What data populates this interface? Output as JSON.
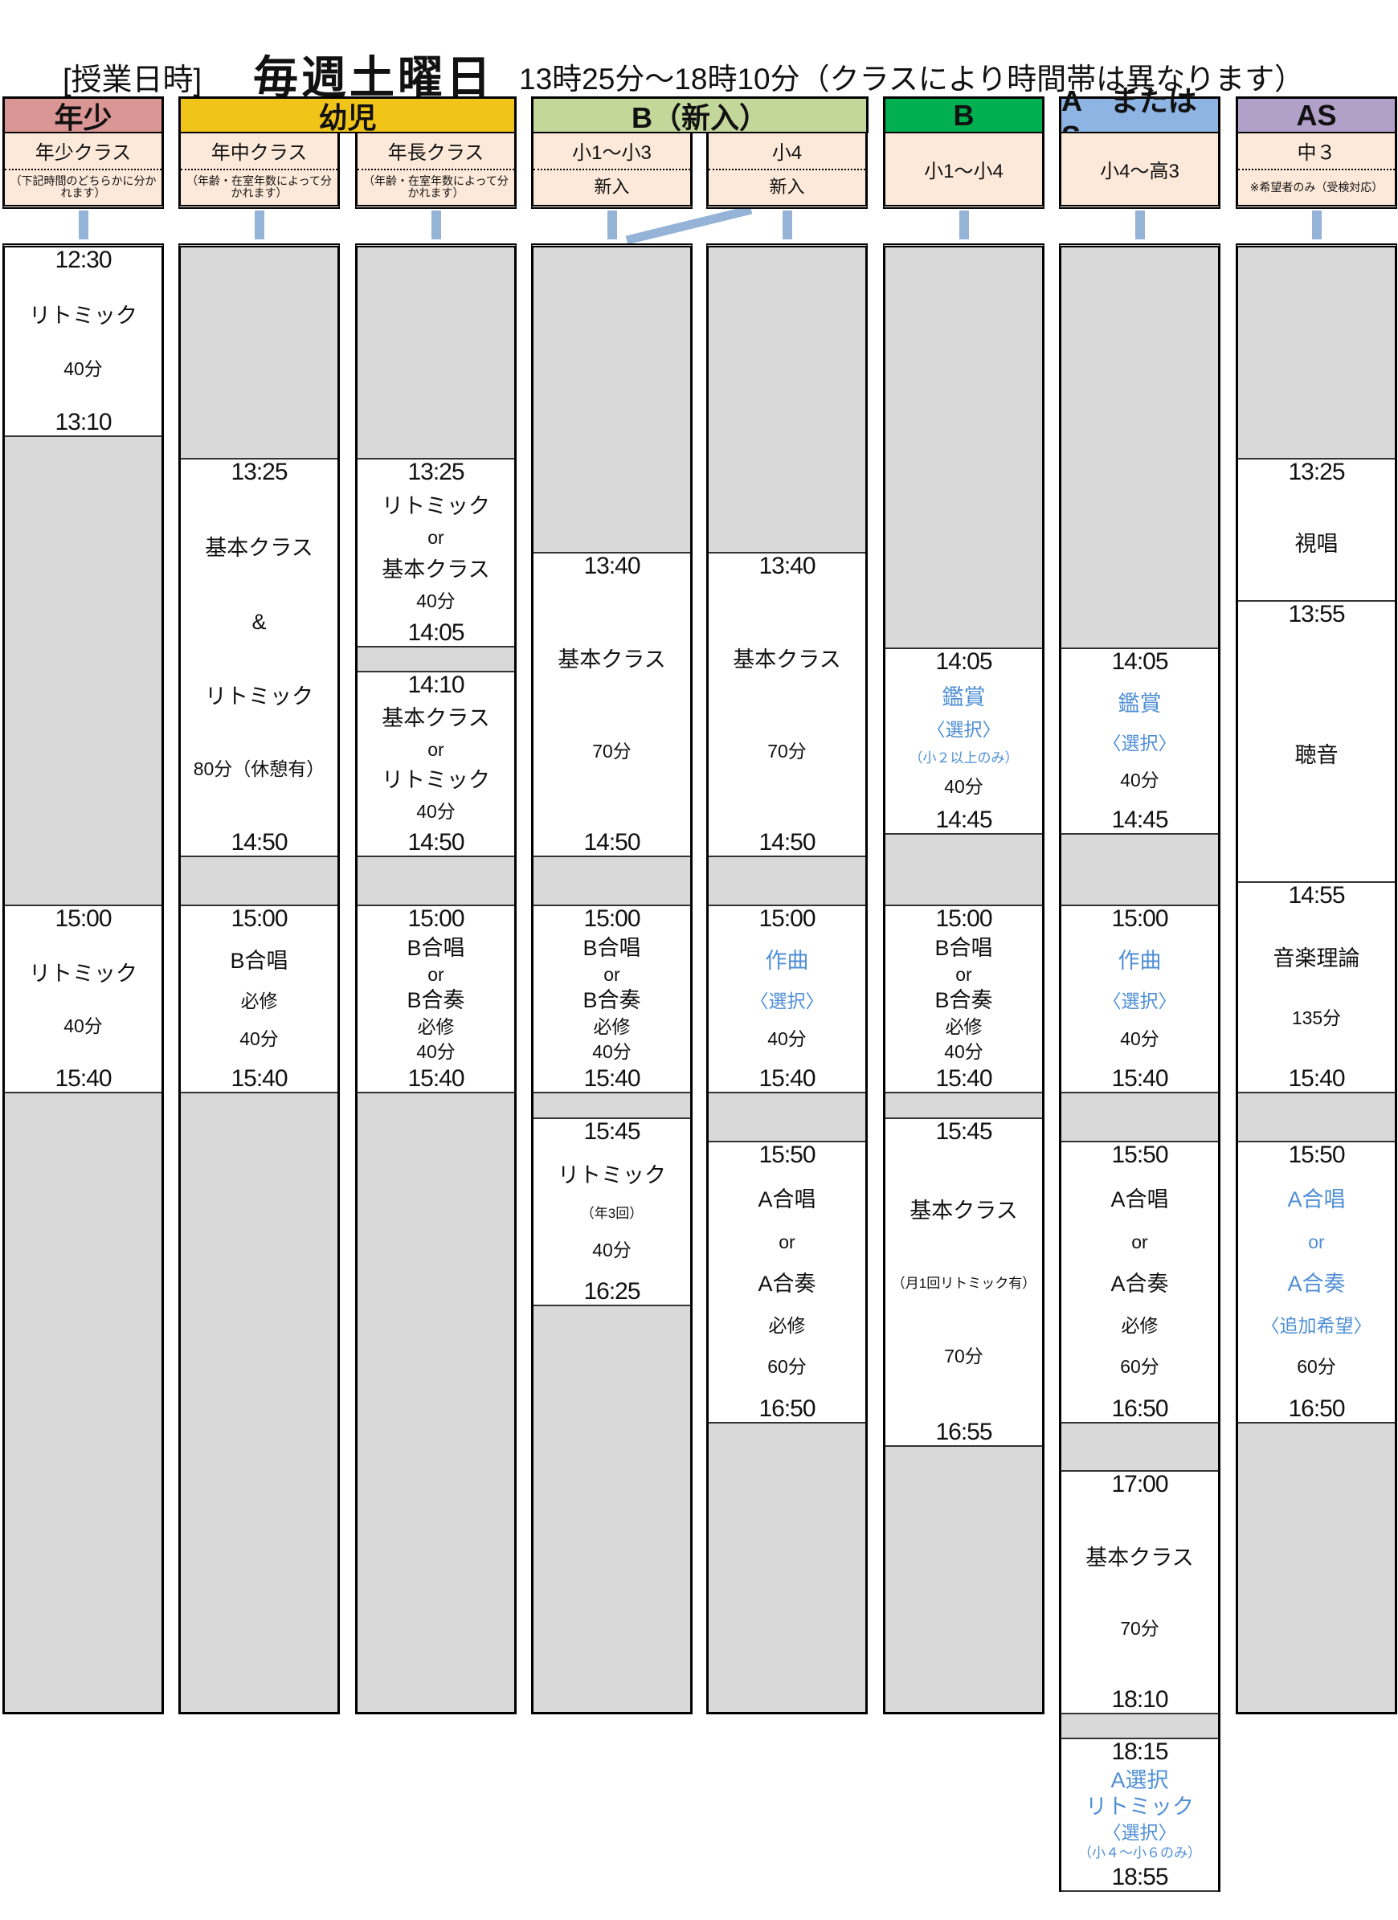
{
  "header": {
    "label": "[授業日時]",
    "day": "毎週土曜日",
    "hours": "13時25分～18時10分（クラスにより時間帯は異なります）"
  },
  "colors": {
    "nensho": "#DA9694",
    "yoji": "#F0C419",
    "b_shinnyu": "#C4D79B",
    "b": "#00B050",
    "a_or_s": "#8DB4E2",
    "as": "#B1A0C7",
    "subheader": "#FDE9D9",
    "empty_slot": "#D9D9D9",
    "connector": "#95B3D7",
    "optional_text": "#4F8FD6"
  },
  "groups": [
    {
      "label": "年少",
      "color": "#DA9694"
    },
    {
      "label": "幼児",
      "color": "#F0C419"
    },
    {
      "label": "B（新入）",
      "color": "#C4D79B"
    },
    {
      "label": "B",
      "color": "#00B050"
    },
    {
      "label": "A　または　S",
      "color": "#8DB4E2"
    },
    {
      "label": "AS",
      "color": "#B1A0C7"
    }
  ],
  "columns": [
    {
      "name": "年少クラス",
      "note": "（下記時間のどちらかに分かれます）",
      "blocks": [
        {
          "start": "12:30",
          "end": "13:10",
          "lines": [
            {
              "t": "リトミック",
              "k": "main"
            },
            {
              "t": "40分",
              "k": "dur"
            }
          ]
        },
        {
          "start": "15:00",
          "end": "15:40",
          "lines": [
            {
              "t": "リトミック",
              "k": "main"
            },
            {
              "t": "40分",
              "k": "dur"
            }
          ]
        }
      ]
    },
    {
      "name": "年中クラス",
      "note": "（年齢・在室年数によって分かれます）",
      "blocks": [
        {
          "start": "13:25",
          "end": "14:50",
          "lines": [
            {
              "t": "基本クラス",
              "k": "main"
            },
            {
              "t": "&",
              "k": "main"
            },
            {
              "t": "リトミック",
              "k": "main"
            },
            {
              "t": "80分（休憩有）",
              "k": "dur"
            }
          ]
        },
        {
          "start": "15:00",
          "end": "15:40",
          "lines": [
            {
              "t": "B合唱",
              "k": "main"
            },
            {
              "t": "必修",
              "k": "dur"
            },
            {
              "t": "40分",
              "k": "dur"
            }
          ]
        }
      ]
    },
    {
      "name": "年長クラス",
      "note": "（年齢・在室年数によって分かれます）",
      "blocks": [
        {
          "start": "13:25",
          "end": "14:05",
          "lines": [
            {
              "t": "リトミック",
              "k": "main"
            },
            {
              "t": "or",
              "k": "dur"
            },
            {
              "t": "基本クラス",
              "k": "main"
            },
            {
              "t": "40分",
              "k": "dur"
            }
          ]
        },
        {
          "start": "14:10",
          "end": "14:50",
          "lines": [
            {
              "t": "基本クラス",
              "k": "main"
            },
            {
              "t": "or",
              "k": "dur"
            },
            {
              "t": "リトミック",
              "k": "main"
            },
            {
              "t": "40分",
              "k": "dur"
            }
          ]
        },
        {
          "start": "15:00",
          "end": "15:40",
          "lines": [
            {
              "t": "B合唱",
              "k": "main"
            },
            {
              "t": "or",
              "k": "dur"
            },
            {
              "t": "B合奏",
              "k": "main"
            },
            {
              "t": "必修",
              "k": "dur"
            },
            {
              "t": "40分",
              "k": "dur"
            }
          ]
        }
      ]
    },
    {
      "name": "小1～小3",
      "note": "新入",
      "blocks": [
        {
          "start": "13:40",
          "end": "14:50",
          "lines": [
            {
              "t": "基本クラス",
              "k": "main"
            },
            {
              "t": "70分",
              "k": "dur"
            }
          ]
        },
        {
          "start": "15:00",
          "end": "15:40",
          "lines": [
            {
              "t": "B合唱",
              "k": "main"
            },
            {
              "t": "or",
              "k": "dur"
            },
            {
              "t": "B合奏",
              "k": "main"
            },
            {
              "t": "必修",
              "k": "dur"
            },
            {
              "t": "40分",
              "k": "dur"
            }
          ]
        },
        {
          "start": "15:45",
          "end": "16:25",
          "lines": [
            {
              "t": "リトミック",
              "k": "main"
            },
            {
              "t": "（年3回）",
              "k": "note"
            },
            {
              "t": "40分",
              "k": "dur"
            }
          ]
        }
      ]
    },
    {
      "name": "小4",
      "note": "新入",
      "blocks": [
        {
          "start": "13:40",
          "end": "14:50",
          "lines": [
            {
              "t": "基本クラス",
              "k": "main"
            },
            {
              "t": "70分",
              "k": "dur"
            }
          ]
        },
        {
          "start": "15:00",
          "end": "15:40",
          "lines": [
            {
              "t": "作曲",
              "k": "main",
              "blue": true
            },
            {
              "t": "〈選択〉",
              "k": "dur",
              "blue": true
            },
            {
              "t": "40分",
              "k": "dur"
            }
          ]
        },
        {
          "start": "15:50",
          "end": "16:50",
          "lines": [
            {
              "t": "A合唱",
              "k": "main"
            },
            {
              "t": "or",
              "k": "dur"
            },
            {
              "t": "A合奏",
              "k": "main"
            },
            {
              "t": "必修",
              "k": "dur"
            },
            {
              "t": "60分",
              "k": "dur"
            }
          ]
        }
      ]
    },
    {
      "name": "小1～小4",
      "note": "",
      "blocks": [
        {
          "start": "14:05",
          "end": "14:45",
          "lines": [
            {
              "t": "鑑賞",
              "k": "main",
              "blue": true
            },
            {
              "t": "〈選択〉",
              "k": "dur",
              "blue": true
            },
            {
              "t": "（小２以上のみ）",
              "k": "note",
              "blue": true
            },
            {
              "t": "40分",
              "k": "dur"
            }
          ]
        },
        {
          "start": "15:00",
          "end": "15:40",
          "lines": [
            {
              "t": "B合唱",
              "k": "main"
            },
            {
              "t": "or",
              "k": "dur"
            },
            {
              "t": "B合奏",
              "k": "main"
            },
            {
              "t": "必修",
              "k": "dur"
            },
            {
              "t": "40分",
              "k": "dur"
            }
          ]
        },
        {
          "start": "15:45",
          "end": "16:55",
          "lines": [
            {
              "t": "基本クラス",
              "k": "main"
            },
            {
              "t": "（月1回リトミック有）",
              "k": "note"
            },
            {
              "t": "70分",
              "k": "dur"
            }
          ]
        }
      ]
    },
    {
      "name": "小4～高3",
      "note": "",
      "blocks": [
        {
          "start": "14:05",
          "end": "14:45",
          "lines": [
            {
              "t": "鑑賞",
              "k": "main",
              "blue": true
            },
            {
              "t": "〈選択〉",
              "k": "dur",
              "blue": true
            },
            {
              "t": "40分",
              "k": "dur"
            }
          ]
        },
        {
          "start": "15:00",
          "end": "15:40",
          "lines": [
            {
              "t": "作曲",
              "k": "main",
              "blue": true
            },
            {
              "t": "〈選択〉",
              "k": "dur",
              "blue": true
            },
            {
              "t": "40分",
              "k": "dur"
            }
          ]
        },
        {
          "start": "15:50",
          "end": "16:50",
          "lines": [
            {
              "t": "A合唱",
              "k": "main"
            },
            {
              "t": "or",
              "k": "dur"
            },
            {
              "t": "A合奏",
              "k": "main"
            },
            {
              "t": "必修",
              "k": "dur"
            },
            {
              "t": "60分",
              "k": "dur"
            }
          ]
        },
        {
          "start": "17:00",
          "end": "18:10",
          "lines": [
            {
              "t": "基本クラス",
              "k": "main"
            },
            {
              "t": "70分",
              "k": "dur"
            }
          ]
        },
        {
          "start": "18:15",
          "end": "18:55",
          "lines": [
            {
              "t": "A選択",
              "k": "main",
              "blue": true
            },
            {
              "t": "リトミック",
              "k": "main",
              "blue": true
            },
            {
              "t": "〈選択〉",
              "k": "dur",
              "blue": true
            },
            {
              "t": "（小４～小６のみ）",
              "k": "note",
              "blue": true
            }
          ]
        }
      ]
    },
    {
      "name": "中３",
      "note": "※希望者のみ（受検対応）",
      "blocks": [
        {
          "start": "13:25",
          "end": "",
          "lines": [
            {
              "t": "視唱",
              "k": "main"
            }
          ]
        },
        {
          "start": "13:55",
          "end": "",
          "lines": [
            {
              "t": "聴音",
              "k": "main"
            }
          ]
        },
        {
          "start": "14:55",
          "end": "15:40",
          "lines": [
            {
              "t": "音楽理論",
              "k": "main"
            },
            {
              "t": "135分",
              "k": "dur"
            }
          ]
        },
        {
          "start": "15:50",
          "end": "16:50",
          "lines": [
            {
              "t": "A合唱",
              "k": "main",
              "blue": true
            },
            {
              "t": "or",
              "k": "dur",
              "blue": true
            },
            {
              "t": "A合奏",
              "k": "main",
              "blue": true
            },
            {
              "t": "〈追加希望〉",
              "k": "dur",
              "blue": true
            },
            {
              "t": "60分",
              "k": "dur"
            }
          ]
        }
      ]
    }
  ]
}
